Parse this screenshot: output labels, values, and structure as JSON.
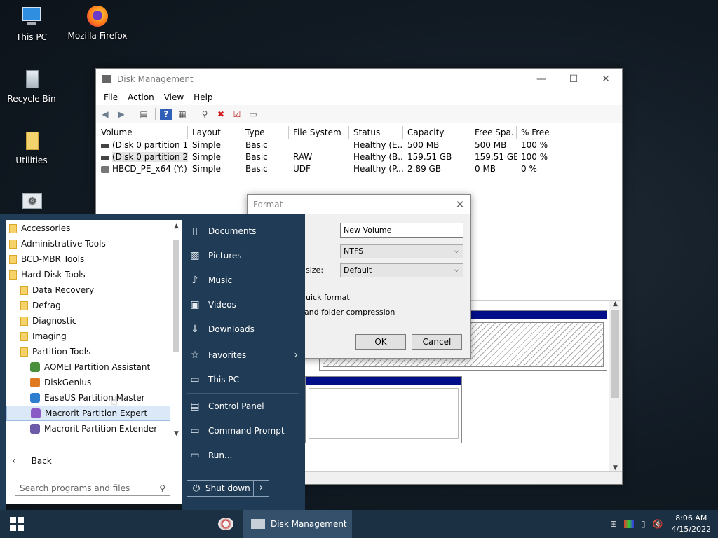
{
  "desktop": {
    "icons": [
      {
        "label": "This PC",
        "icon": "computer-icon"
      },
      {
        "label": "Mozilla Firefox",
        "icon": "firefox-icon"
      },
      {
        "label": "Recycle Bin",
        "icon": "recycle-bin-icon"
      },
      {
        "label": "Utilities",
        "icon": "folder-icon"
      }
    ]
  },
  "disk_mgmt": {
    "title": "Disk Management",
    "menu": [
      "File",
      "Action",
      "View",
      "Help"
    ],
    "columns": [
      "Volume",
      "Layout",
      "Type",
      "File System",
      "Status",
      "Capacity",
      "Free Spa...",
      "% Free"
    ],
    "rows": [
      [
        "(Disk 0 partition 1)",
        "Simple",
        "Basic",
        "",
        "Healthy (E...",
        "500 MB",
        "500 MB",
        "100 %"
      ],
      [
        "(Disk 0 partition 2)",
        "Simple",
        "Basic",
        "RAW",
        "Healthy (B...",
        "159.51 GB",
        "159.51 GB",
        "100 %"
      ],
      [
        "HBCD_PE_x64 (Y:)",
        "Simple",
        "Basic",
        "UDF",
        "Healthy (P...",
        "2.89 GB",
        "0 MB",
        "0 %"
      ]
    ]
  },
  "format_dialog": {
    "title": "Format",
    "volume_label_value": "New Volume",
    "file_system_value": "NTFS",
    "alloc_label": "size:",
    "alloc_value": "Default",
    "quick_format": "uick format",
    "compression": "and folder compression",
    "ok": "OK",
    "cancel": "Cancel"
  },
  "start_menu": {
    "programs": [
      {
        "label": "Accessories",
        "type": "folder",
        "indent": 0
      },
      {
        "label": "Administrative Tools",
        "type": "folder",
        "indent": 0
      },
      {
        "label": "BCD-MBR Tools",
        "type": "folder",
        "indent": 0
      },
      {
        "label": "Hard Disk Tools",
        "type": "folder",
        "indent": 0
      },
      {
        "label": "Data Recovery",
        "type": "folder",
        "indent": 1
      },
      {
        "label": "Defrag",
        "type": "folder",
        "indent": 1
      },
      {
        "label": "Diagnostic",
        "type": "folder",
        "indent": 1
      },
      {
        "label": "Imaging",
        "type": "folder",
        "indent": 1
      },
      {
        "label": "Partition Tools",
        "type": "folder",
        "indent": 1
      },
      {
        "label": "AOMEI Partition Assistant",
        "type": "app",
        "indent": 2,
        "color": "#4a8f3c"
      },
      {
        "label": "DiskGenius",
        "type": "app",
        "indent": 2,
        "color": "#e07a20"
      },
      {
        "label": "EaseUS Partition Master",
        "type": "app",
        "indent": 2,
        "color": "#2f7fd0"
      },
      {
        "label": "Macrorit Partition Expert",
        "type": "app",
        "indent": 2,
        "color": "#8a5bc4",
        "selected": true
      },
      {
        "label": "Macrorit Partition Extender",
        "type": "app",
        "indent": 2,
        "color": "#6d5aa8"
      }
    ],
    "back": "Back",
    "search_placeholder": "Search programs and files",
    "right_items": [
      {
        "label": "Documents",
        "icon": "document-icon"
      },
      {
        "label": "Pictures",
        "icon": "picture-icon"
      },
      {
        "label": "Music",
        "icon": "music-icon"
      },
      {
        "label": "Videos",
        "icon": "video-icon"
      },
      {
        "label": "Downloads",
        "icon": "download-icon"
      },
      {
        "label": "Favorites",
        "icon": "star-icon"
      },
      {
        "label": "This PC",
        "icon": "computer-icon"
      },
      {
        "label": "Control Panel",
        "icon": "control-panel-icon"
      },
      {
        "label": "Command Prompt",
        "icon": "command-prompt-icon"
      },
      {
        "label": "Run...",
        "icon": "run-icon"
      }
    ],
    "shutdown": "Shut down"
  },
  "taskbar": {
    "active_task": "Disk Management",
    "time": "8:06 AM",
    "date": "4/15/2022"
  }
}
